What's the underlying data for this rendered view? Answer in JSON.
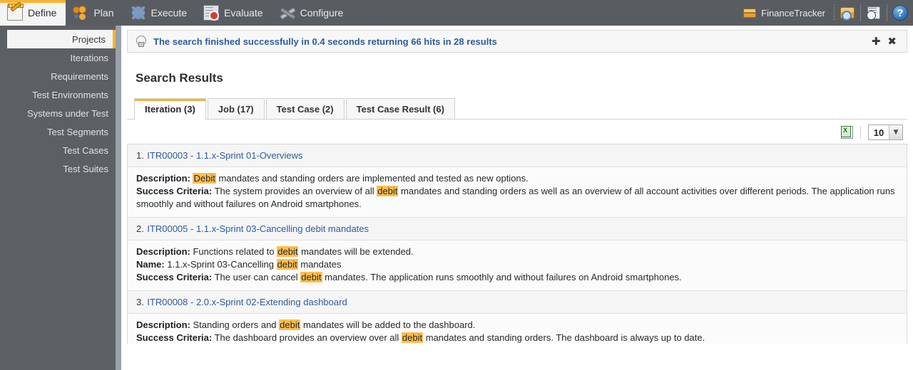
{
  "topnav": {
    "items": [
      {
        "label": "Define",
        "icon": "notepad-icon",
        "active": true
      },
      {
        "label": "Plan",
        "icon": "people-icon",
        "active": false
      },
      {
        "label": "Execute",
        "icon": "gear-icon",
        "active": false
      },
      {
        "label": "Evaluate",
        "icon": "report-icon",
        "active": false
      },
      {
        "label": "Configure",
        "icon": "tools-icon",
        "active": false
      }
    ],
    "project": {
      "label": "FinanceTracker",
      "icon": "project-box-icon"
    },
    "buttons": [
      {
        "name": "search-project-icon",
        "label": ""
      },
      {
        "name": "history-icon",
        "label": ""
      },
      {
        "name": "help-icon",
        "label": "?"
      }
    ]
  },
  "sidebar": {
    "items": [
      {
        "label": "Projects",
        "active": true
      },
      {
        "label": "Iterations",
        "active": false
      },
      {
        "label": "Requirements",
        "active": false
      },
      {
        "label": "Test Environments",
        "active": false
      },
      {
        "label": "Systems under Test",
        "active": false
      },
      {
        "label": "Test Segments",
        "active": false
      },
      {
        "label": "Test Cases",
        "active": false
      },
      {
        "label": "Test Suites",
        "active": false
      }
    ]
  },
  "notice": {
    "icon": "lightbulb-icon",
    "message": "The search finished successfully in 0.4 seconds returning 66 hits in 28 results",
    "add_label": "✚",
    "close_label": "✖"
  },
  "page": {
    "title": "Search Results"
  },
  "tabs": [
    {
      "label": "Iteration (3)",
      "active": true
    },
    {
      "label": "Job (17)",
      "active": false
    },
    {
      "label": "Test Case (2)",
      "active": false
    },
    {
      "label": "Test Case Result (6)",
      "active": false
    }
  ],
  "toolbar": {
    "export_icon": "excel-export-icon",
    "page_size": "10",
    "dropdown_arrow": "▼"
  },
  "colors": {
    "accent": "#f9b233",
    "highlight": "#ffbe4d",
    "link": "#2d5c9e",
    "chrome": "#595d61",
    "sidebar": "#5c6064"
  },
  "results": [
    {
      "index": "1.",
      "title": "ITR00003 - 1.1.x-Sprint 01-Overviews",
      "fields": [
        {
          "label": "Description:",
          "parts": [
            {
              "t": " ",
              "h": false
            },
            {
              "t": "Debit",
              "h": true
            },
            {
              "t": " mandates and standing orders are implemented and tested as new options.",
              "h": false
            }
          ]
        },
        {
          "label": "Success Criteria:",
          "parts": [
            {
              "t": "  The system provides an overview of all ",
              "h": false
            },
            {
              "t": "debit",
              "h": true
            },
            {
              "t": " mandates and standing orders as well as an overview of all account activities over different periods. The application runs smoothly and without failures on Android smartphones.",
              "h": false
            }
          ]
        }
      ]
    },
    {
      "index": "2.",
      "title": "ITR00005 - 1.1.x-Sprint 03-Cancelling debit mandates",
      "fields": [
        {
          "label": "Description:",
          "parts": [
            {
              "t": "  Functions related to ",
              "h": false
            },
            {
              "t": "debit",
              "h": true
            },
            {
              "t": " mandates will be extended.",
              "h": false
            }
          ]
        },
        {
          "label": "Name:",
          "parts": [
            {
              "t": "  1.1.x-Sprint 03-Cancelling ",
              "h": false
            },
            {
              "t": "debit",
              "h": true
            },
            {
              "t": " mandates",
              "h": false
            }
          ]
        },
        {
          "label": "Success Criteria:",
          "parts": [
            {
              "t": "  The user can cancel ",
              "h": false
            },
            {
              "t": "debit",
              "h": true
            },
            {
              "t": " mandates. The application runs smoothly and without failures on Android smartphones.",
              "h": false
            }
          ]
        }
      ]
    },
    {
      "index": "3.",
      "title": "ITR00008 - 2.0.x-Sprint 02-Extending dashboard",
      "fields": [
        {
          "label": "Description:",
          "parts": [
            {
              "t": "  Standing orders and ",
              "h": false
            },
            {
              "t": "debit",
              "h": true
            },
            {
              "t": " mandates will be added to the dashboard.",
              "h": false
            }
          ]
        },
        {
          "label": "Success Criteria:",
          "parts": [
            {
              "t": "  The dashboard provides an overview over all ",
              "h": false
            },
            {
              "t": "debit",
              "h": true
            },
            {
              "t": " mandates and standing orders. The dashboard is always up to date.",
              "h": false
            }
          ]
        }
      ]
    }
  ]
}
